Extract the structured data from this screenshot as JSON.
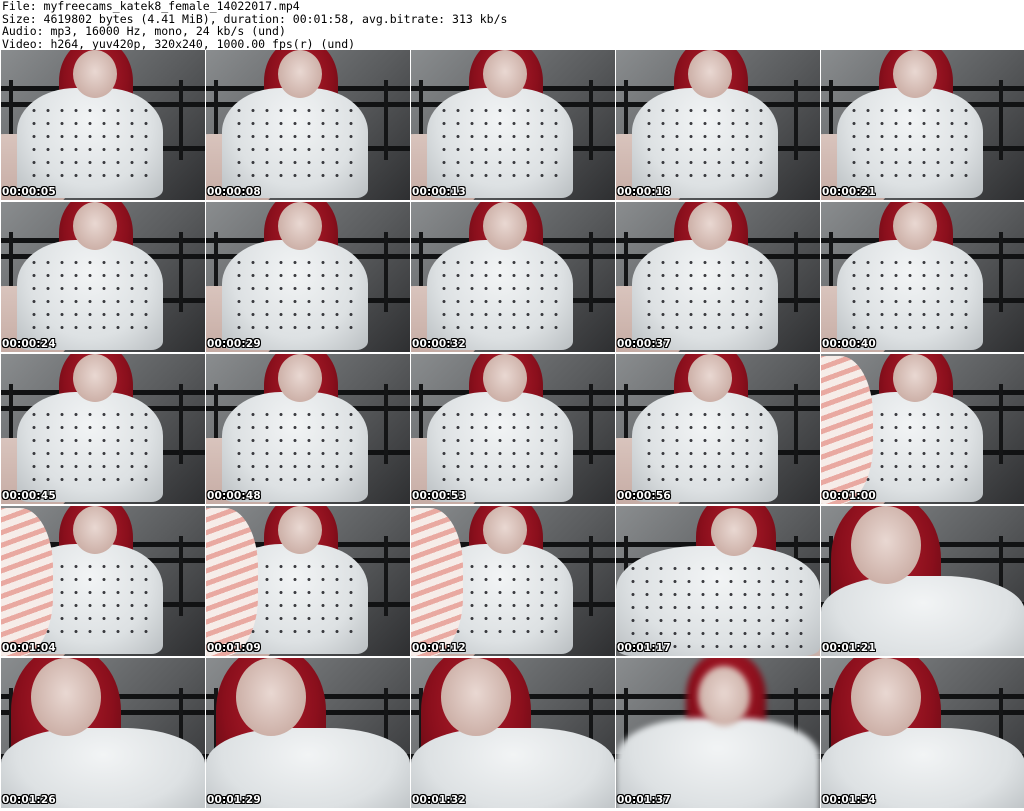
{
  "header": {
    "line1": "File: myfreecams_katek8_female_14022017.mp4",
    "line2": "Size: 4619802 bytes (4.41 MiB), duration: 00:01:58, avg.bitrate: 313 kb/s",
    "line3": "Audio: mp3, 16000 Hz, mono, 24 kb/s (und)",
    "line4": "Video: h264, yuv420p, 320x240, 1000.00 fps(r) (und)"
  },
  "frames": [
    {
      "time": "00:00:05",
      "shot": "wide"
    },
    {
      "time": "00:00:08",
      "shot": "wide"
    },
    {
      "time": "00:00:13",
      "shot": "wide"
    },
    {
      "time": "00:00:18",
      "shot": "wide"
    },
    {
      "time": "00:00:21",
      "shot": "wide"
    },
    {
      "time": "00:00:24",
      "shot": "wide"
    },
    {
      "time": "00:00:29",
      "shot": "wide"
    },
    {
      "time": "00:00:32",
      "shot": "wide"
    },
    {
      "time": "00:00:37",
      "shot": "wide"
    },
    {
      "time": "00:00:40",
      "shot": "wide"
    },
    {
      "time": "00:00:45",
      "shot": "wide"
    },
    {
      "time": "00:00:48",
      "shot": "wide"
    },
    {
      "time": "00:00:53",
      "shot": "wide"
    },
    {
      "time": "00:00:56",
      "shot": "wide"
    },
    {
      "time": "00:01:00",
      "shot": "sock"
    },
    {
      "time": "00:01:04",
      "shot": "sock"
    },
    {
      "time": "00:01:09",
      "shot": "sock"
    },
    {
      "time": "00:01:12",
      "shot": "sock"
    },
    {
      "time": "00:01:17",
      "shot": "lean"
    },
    {
      "time": "00:01:21",
      "shot": "close"
    },
    {
      "time": "00:01:26",
      "shot": "close"
    },
    {
      "time": "00:01:29",
      "shot": "close"
    },
    {
      "time": "00:01:32",
      "shot": "close"
    },
    {
      "time": "00:01:37",
      "shot": "blur"
    },
    {
      "time": "00:01:54",
      "shot": "close"
    }
  ],
  "colors": {
    "hair": "#8a0f1c",
    "sweater": "#e4e7e9",
    "background": "#ffffff",
    "timestamp": "#ffffff"
  }
}
